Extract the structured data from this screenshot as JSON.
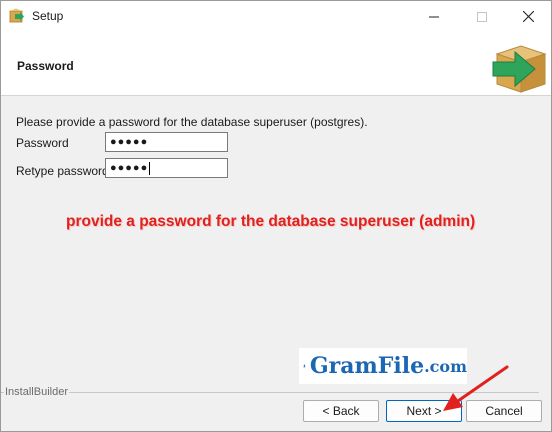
{
  "window": {
    "title": "Setup",
    "controls": {
      "minimize": "minimize",
      "maximize": "maximize",
      "close": "close"
    }
  },
  "header": {
    "title": "Password",
    "logo_icon": "box-with-green-arrow-icon"
  },
  "content": {
    "instruction": "Please provide a password for the database superuser (postgres).",
    "fields": [
      {
        "label": "Password",
        "value": "●●●●●"
      },
      {
        "label": "Retype password",
        "value": "●●●●●"
      }
    ],
    "annotation": "provide a password for the database superuser (admin)"
  },
  "watermark": {
    "name": "GramFile",
    "suffix": ".com"
  },
  "footer": {
    "brand": "InstallBuilder",
    "buttons": {
      "back": "< Back",
      "next": "Next >",
      "cancel": "Cancel"
    }
  },
  "colors": {
    "annotation": "#e0211d",
    "watermark": "#1b67b4",
    "focus_border": "#0067c0"
  }
}
